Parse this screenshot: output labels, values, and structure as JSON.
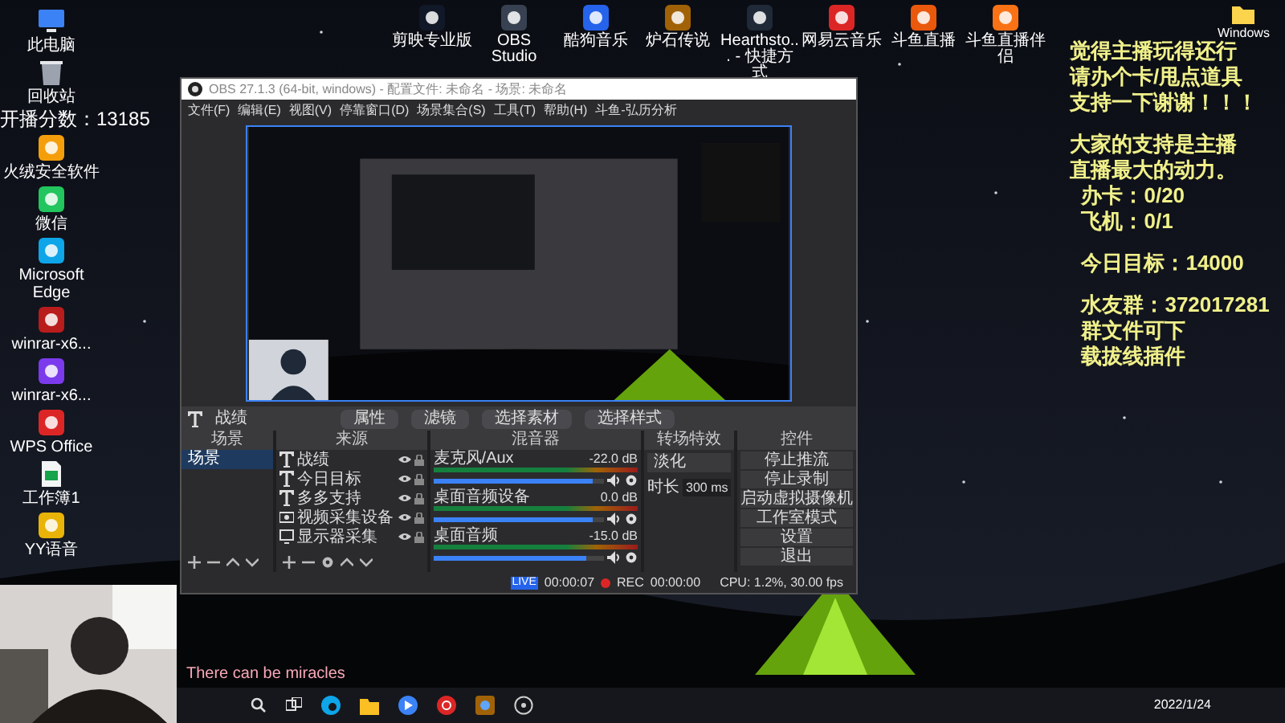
{
  "desktop_icons": [
    {
      "label": "此电脑",
      "kind": "monitor",
      "color": "#3b82f6"
    },
    {
      "label": "回收站",
      "kind": "trash",
      "color": "#9ca3af"
    },
    {
      "label": "火绒安全软件",
      "kind": "app",
      "color": "#f59e0b"
    },
    {
      "label": "微信",
      "kind": "app",
      "color": "#22c55e"
    },
    {
      "label": "Microsoft Edge",
      "kind": "app",
      "color": "#0ea5e9"
    },
    {
      "label": "winrar-x6...",
      "kind": "app",
      "color": "#b91c1c"
    },
    {
      "label": "winrar-x6...",
      "kind": "app",
      "color": "#7c3aed"
    },
    {
      "label": "WPS Office",
      "kind": "app",
      "color": "#dc2626"
    },
    {
      "label": "工作簿1",
      "kind": "document",
      "color": "#16a34a"
    },
    {
      "label": "YY语音",
      "kind": "app",
      "color": "#eab308"
    }
  ],
  "top_icons": [
    {
      "label": "剪映专业版",
      "color": "#111827"
    },
    {
      "label": "OBS Studio",
      "color": "#374151"
    },
    {
      "label": "酷狗音乐",
      "color": "#2563eb"
    },
    {
      "label": "炉石传说",
      "color": "#a16207"
    },
    {
      "label": "Hearthsto... - 快捷方式",
      "color": "#1f2937"
    },
    {
      "label": "网易云音乐",
      "color": "#dc2626"
    },
    {
      "label": "斗鱼直播",
      "color": "#ea580c"
    },
    {
      "label": "斗鱼直播伴侣",
      "color": "#f97316"
    }
  ],
  "recycle_folder": {
    "label": "Windows"
  },
  "score_overlay": "开播分数：13185",
  "obs": {
    "title": "OBS 27.1.3 (64-bit, windows) - 配置文件: 未命名 - 场景: 未命名",
    "menu": [
      "文件(F)",
      "编辑(E)",
      "视图(V)",
      "停靠窗口(D)",
      "场景集合(S)",
      "工具(T)",
      "帮助(H)",
      "斗鱼-弘历分析"
    ],
    "source_toolbar": {
      "source": "战绩",
      "buttons": [
        "属性",
        "滤镜",
        "选择素材",
        "选择样式"
      ]
    },
    "scenes": {
      "title": "场景",
      "items": [
        {
          "label": "场景",
          "selected": true
        }
      ]
    },
    "sources": {
      "title": "来源",
      "items": [
        {
          "label": "战绩",
          "kind": "text"
        },
        {
          "label": "今日目标",
          "kind": "text"
        },
        {
          "label": "多多支持",
          "kind": "text"
        },
        {
          "label": "视频采集设备",
          "kind": "camera"
        },
        {
          "label": "显示器采集",
          "kind": "display"
        }
      ]
    },
    "mixer": {
      "title": "混音器",
      "channels": [
        {
          "name": "麦克风/Aux",
          "reading": "-22.0 dB",
          "level": 0.93
        },
        {
          "name": "桌面音频设备",
          "reading": "0.0 dB",
          "level": 0.93
        },
        {
          "name": "桌面音频",
          "reading": "-15.0 dB",
          "level": 0.9
        }
      ]
    },
    "transitions": {
      "title": "转场特效",
      "type": "淡化",
      "duration_label": "时长",
      "duration": "300 ms"
    },
    "controls": {
      "title": "控件",
      "buttons": [
        "停止推流",
        "停止录制",
        "启动虚拟摄像机",
        "工作室模式",
        "设置",
        "退出"
      ]
    },
    "status": {
      "live": "LIVE",
      "live_time": "00:00:07",
      "rec": "REC",
      "rec_time": "00:00:00",
      "cpu": "CPU: 1.2%, 30.00 fps"
    }
  },
  "overlay_blocks": [
    [
      "觉得主播玩得还行",
      "请办个卡/甩点道具",
      "支持一下谢谢！！！"
    ],
    [
      "大家的支持是主播",
      "直播最大的动力。",
      "  办卡：0/20",
      "  飞机：0/1"
    ],
    [
      "  今日目标：14000"
    ],
    [
      "  水友群：372017281",
      "  群文件可下",
      "  载拔线插件"
    ]
  ],
  "subtitle": "There can be miracles",
  "taskbar": {
    "date": "2022/1/24"
  }
}
